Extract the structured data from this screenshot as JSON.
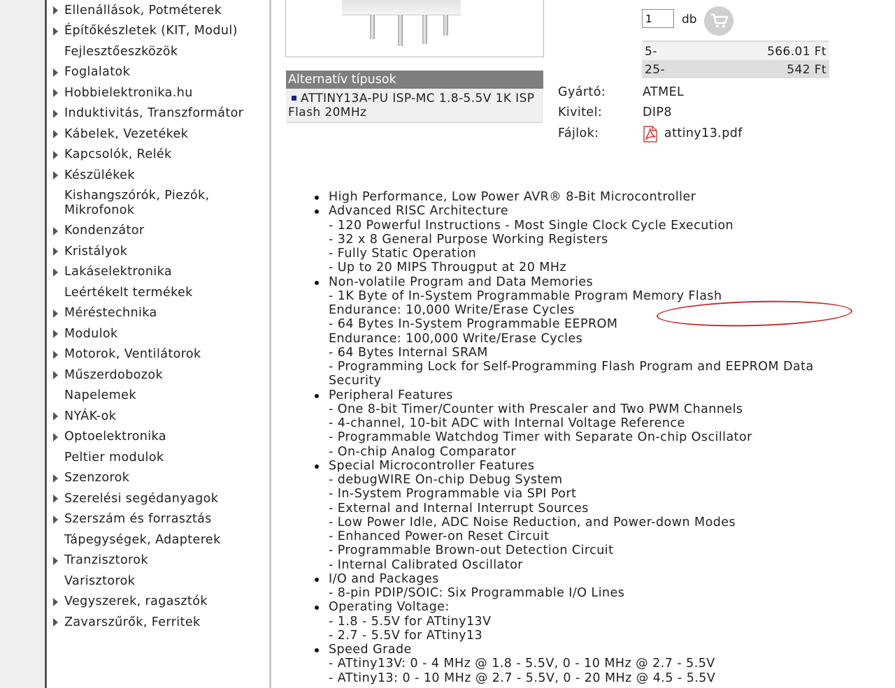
{
  "sidebar": {
    "items": [
      {
        "label": "Ellenállások, Potméterek",
        "arrow": true
      },
      {
        "label": "Építőkészletek (KIT, Modul)",
        "arrow": true
      },
      {
        "label": "Fejlesztőeszközök",
        "arrow": false
      },
      {
        "label": "Foglalatok",
        "arrow": true
      },
      {
        "label": "Hobbielektronika.hu",
        "arrow": true
      },
      {
        "label": "Induktivitás, Transzformátor",
        "arrow": true
      },
      {
        "label": "Kábelek, Vezetékek",
        "arrow": true
      },
      {
        "label": "Kapcsolók, Relék",
        "arrow": true
      },
      {
        "label": "Készülékek",
        "arrow": true
      },
      {
        "label": "Kishangszórók, Piezók, Mikrofonok",
        "arrow": false
      },
      {
        "label": "Kondenzátor",
        "arrow": true
      },
      {
        "label": "Kristályok",
        "arrow": true
      },
      {
        "label": "Lakáselektronika",
        "arrow": true
      },
      {
        "label": "Leértékelt termékek",
        "arrow": false
      },
      {
        "label": "Méréstechnika",
        "arrow": true
      },
      {
        "label": "Modulok",
        "arrow": true
      },
      {
        "label": "Motorok, Ventilátorok",
        "arrow": true
      },
      {
        "label": "Műszerdobozok",
        "arrow": true
      },
      {
        "label": "Napelemek",
        "arrow": false
      },
      {
        "label": "NYÁK-ok",
        "arrow": true
      },
      {
        "label": "Optoelektronika",
        "arrow": true
      },
      {
        "label": "Peltier modulok",
        "arrow": false
      },
      {
        "label": "Szenzorok",
        "arrow": true
      },
      {
        "label": "Szerelési segédanyagok",
        "arrow": true
      },
      {
        "label": "Szerszám és forrasztás",
        "arrow": true
      },
      {
        "label": "Tápegységek, Adapterek",
        "arrow": false
      },
      {
        "label": "Tranzisztorok",
        "arrow": true
      },
      {
        "label": "Varisztorok",
        "arrow": false
      },
      {
        "label": "Vegyszerek, ragasztók",
        "arrow": true
      },
      {
        "label": "Zavarszűrők, Ferritek",
        "arrow": true
      }
    ]
  },
  "alternatives": {
    "title": "Alternatív típusok",
    "item": "ATTINY13A-PU ISP-MC 1.8-5.5V 1K ISP Flash 20MHz"
  },
  "order": {
    "quantity": "1",
    "unit": "db",
    "prices": [
      {
        "qty": "5-",
        "price": "566.01 Ft"
      },
      {
        "qty": "25-",
        "price": "542 Ft"
      }
    ]
  },
  "specs": {
    "manufacturer_label": "Gyártó:",
    "manufacturer": "ATMEL",
    "package_label": "Kivitel:",
    "package": "DIP8",
    "files_label": "Fájlok:",
    "file": "attiny13.pdf"
  },
  "features": [
    {
      "title": "High Performance, Low Power AVR® 8-Bit Microcontroller",
      "sub": []
    },
    {
      "title": "Advanced RISC Architecture",
      "sub": [
        "- 120 Powerful Instructions - Most Single Clock Cycle Execution",
        "- 32 x 8 General Purpose Working Registers",
        "- Fully Static Operation",
        "- Up to 20 MIPS Througput at 20 MHz"
      ]
    },
    {
      "title": "Non-volatile Program and Data Memories",
      "sub": [
        "- 1K Byte of In-System Programmable Program Memory Flash",
        "Endurance: 10,000 Write/Erase Cycles",
        "- 64 Bytes In-System Programmable EEPROM",
        "Endurance: 100,000 Write/Erase Cycles",
        "- 64 Bytes Internal SRAM",
        "- Programming Lock for Self-Programming Flash Program and EEPROM Data Security"
      ]
    },
    {
      "title": "Peripheral Features",
      "sub": [
        "- One 8-bit Timer/Counter with Prescaler and Two PWM Channels",
        "- 4-channel, 10-bit ADC with Internal Voltage Reference",
        "- Programmable Watchdog Timer with Separate On-chip Oscillator",
        "- On-chip Analog Comparator"
      ]
    },
    {
      "title": "Special Microcontroller Features",
      "sub": [
        "- debugWIRE On-chip Debug System",
        "- In-System Programmable via SPI Port",
        "- External and Internal Interrupt Sources",
        "- Low Power Idle, ADC Noise Reduction, and Power-down Modes",
        "- Enhanced Power-on Reset Circuit",
        "- Programmable Brown-out Detection Circuit",
        "- Internal Calibrated Oscillator"
      ]
    },
    {
      "title": "I/O and Packages",
      "sub": [
        "- 8-pin PDIP/SOIC: Six Programmable I/O Lines"
      ]
    },
    {
      "title": "Operating Voltage:",
      "sub": [
        "- 1.8 - 5.5V for ATtiny13V",
        "- 2.7 - 5.5V for ATtiny13"
      ]
    },
    {
      "title": "Speed Grade",
      "sub": [
        "- ATtiny13V: 0 - 4 MHz @ 1.8 - 5.5V, 0 - 10 MHz @ 2.7 - 5.5V",
        "- ATtiny13: 0 - 10 MHz @ 2.7 - 5.5V, 0 - 20 MHz @ 4.5 - 5.5V"
      ]
    }
  ],
  "colors": {
    "sidebar_arrow": "#555555",
    "alt_header_bg": "#7f7f7f",
    "bullet_blue": "#1a237e",
    "highlight_red": "#c42b2b"
  }
}
